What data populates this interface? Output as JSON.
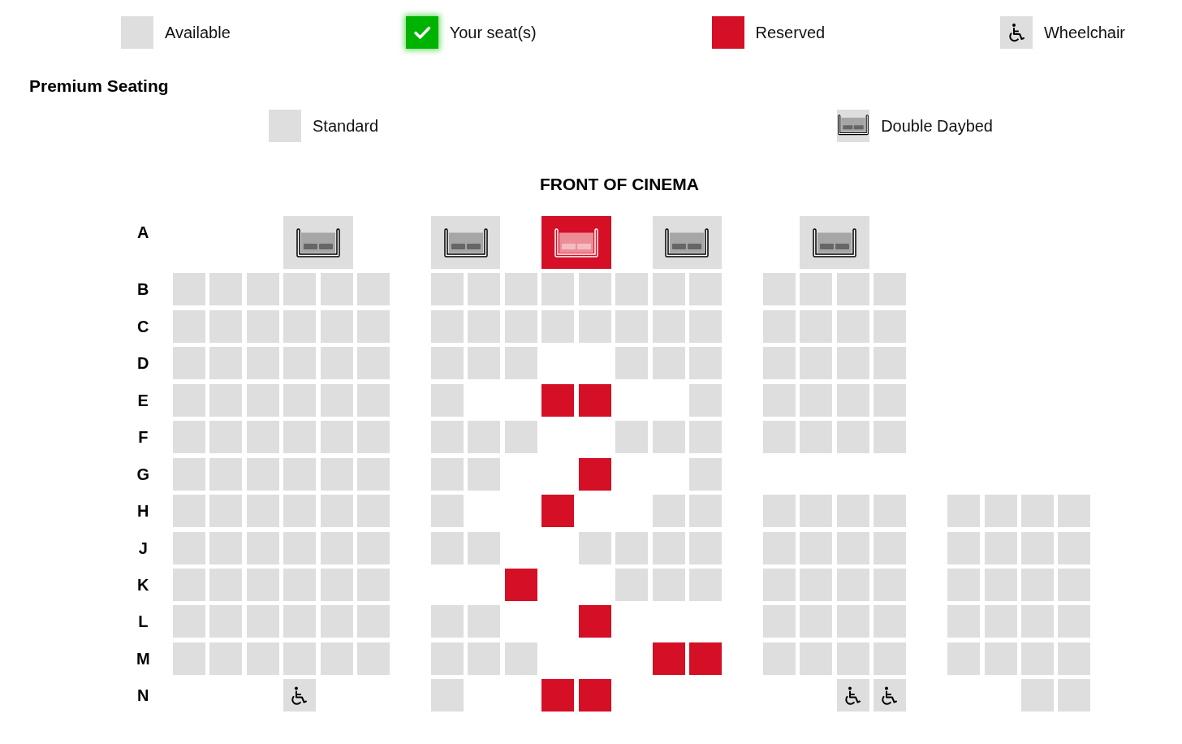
{
  "legend": [
    {
      "kind": "available",
      "label": "Available"
    },
    {
      "kind": "selected",
      "label": "Your seat(s)"
    },
    {
      "kind": "reserved",
      "label": "Reserved"
    },
    {
      "kind": "wheelchair",
      "label": "Wheelchair"
    }
  ],
  "premium": {
    "title": "Premium Seating",
    "legend": [
      {
        "kind": "standard",
        "label": "Standard"
      },
      {
        "kind": "daybed",
        "label": "Double Daybed"
      }
    ]
  },
  "screen_label": "FRONT OF CINEMA",
  "rows": [
    {
      "label": "A",
      "seats": [
        {
          "kind": "space"
        },
        {
          "kind": "space"
        },
        {
          "kind": "space"
        },
        {
          "kind": "daybed",
          "reserved": false
        },
        {
          "kind": "space"
        },
        {
          "kind": "space"
        },
        {
          "kind": "daybed",
          "reserved": false
        },
        {
          "kind": "space"
        },
        {
          "kind": "daybed",
          "reserved": true
        },
        {
          "kind": "space"
        },
        {
          "kind": "daybed",
          "reserved": false
        },
        {
          "kind": "space"
        },
        {
          "kind": "space"
        },
        {
          "kind": "daybed",
          "reserved": false
        }
      ]
    },
    {
      "label": "B",
      "seats": [
        {
          "kind": "seat",
          "reserved": false
        },
        {
          "kind": "seat",
          "reserved": false
        },
        {
          "kind": "seat",
          "reserved": false
        },
        {
          "kind": "seat",
          "reserved": false
        },
        {
          "kind": "seat",
          "reserved": false
        },
        {
          "kind": "seat",
          "reserved": false
        },
        {
          "kind": "space"
        },
        {
          "kind": "seat",
          "reserved": false
        },
        {
          "kind": "seat",
          "reserved": false
        },
        {
          "kind": "seat",
          "reserved": false
        },
        {
          "kind": "seat",
          "reserved": false
        },
        {
          "kind": "seat",
          "reserved": false
        },
        {
          "kind": "seat",
          "reserved": false
        },
        {
          "kind": "seat",
          "reserved": false
        },
        {
          "kind": "seat",
          "reserved": false
        },
        {
          "kind": "space"
        },
        {
          "kind": "seat",
          "reserved": false
        },
        {
          "kind": "seat",
          "reserved": false
        },
        {
          "kind": "seat",
          "reserved": false
        },
        {
          "kind": "seat",
          "reserved": false
        }
      ]
    },
    {
      "label": "C",
      "seats": [
        {
          "kind": "seat",
          "reserved": false
        },
        {
          "kind": "seat",
          "reserved": false
        },
        {
          "kind": "seat",
          "reserved": false
        },
        {
          "kind": "seat",
          "reserved": false
        },
        {
          "kind": "seat",
          "reserved": false
        },
        {
          "kind": "seat",
          "reserved": false
        },
        {
          "kind": "space"
        },
        {
          "kind": "seat",
          "reserved": false
        },
        {
          "kind": "seat",
          "reserved": false
        },
        {
          "kind": "seat",
          "reserved": false
        },
        {
          "kind": "seat",
          "reserved": false
        },
        {
          "kind": "seat",
          "reserved": false
        },
        {
          "kind": "seat",
          "reserved": false
        },
        {
          "kind": "seat",
          "reserved": false
        },
        {
          "kind": "seat",
          "reserved": false
        },
        {
          "kind": "space"
        },
        {
          "kind": "seat",
          "reserved": false
        },
        {
          "kind": "seat",
          "reserved": false
        },
        {
          "kind": "seat",
          "reserved": false
        },
        {
          "kind": "seat",
          "reserved": false
        }
      ]
    },
    {
      "label": "D",
      "seats": [
        {
          "kind": "seat",
          "reserved": false
        },
        {
          "kind": "seat",
          "reserved": false
        },
        {
          "kind": "seat",
          "reserved": false
        },
        {
          "kind": "seat",
          "reserved": false
        },
        {
          "kind": "seat",
          "reserved": false
        },
        {
          "kind": "seat",
          "reserved": false
        },
        {
          "kind": "space"
        },
        {
          "kind": "seat",
          "reserved": false
        },
        {
          "kind": "seat",
          "reserved": false
        },
        {
          "kind": "seat",
          "reserved": false
        },
        {
          "kind": "space"
        },
        {
          "kind": "space"
        },
        {
          "kind": "seat",
          "reserved": false
        },
        {
          "kind": "seat",
          "reserved": false
        },
        {
          "kind": "seat",
          "reserved": false
        },
        {
          "kind": "space"
        },
        {
          "kind": "seat",
          "reserved": false
        },
        {
          "kind": "seat",
          "reserved": false
        },
        {
          "kind": "seat",
          "reserved": false
        },
        {
          "kind": "seat",
          "reserved": false
        }
      ]
    },
    {
      "label": "E",
      "seats": [
        {
          "kind": "seat",
          "reserved": false
        },
        {
          "kind": "seat",
          "reserved": false
        },
        {
          "kind": "seat",
          "reserved": false
        },
        {
          "kind": "seat",
          "reserved": false
        },
        {
          "kind": "seat",
          "reserved": false
        },
        {
          "kind": "seat",
          "reserved": false
        },
        {
          "kind": "space"
        },
        {
          "kind": "seat",
          "reserved": false
        },
        {
          "kind": "space"
        },
        {
          "kind": "space"
        },
        {
          "kind": "seat",
          "reserved": true
        },
        {
          "kind": "seat",
          "reserved": true
        },
        {
          "kind": "space"
        },
        {
          "kind": "space"
        },
        {
          "kind": "seat",
          "reserved": false
        },
        {
          "kind": "space"
        },
        {
          "kind": "seat",
          "reserved": false
        },
        {
          "kind": "seat",
          "reserved": false
        },
        {
          "kind": "seat",
          "reserved": false
        },
        {
          "kind": "seat",
          "reserved": false
        }
      ]
    },
    {
      "label": "F",
      "seats": [
        {
          "kind": "seat",
          "reserved": false
        },
        {
          "kind": "seat",
          "reserved": false
        },
        {
          "kind": "seat",
          "reserved": false
        },
        {
          "kind": "seat",
          "reserved": false
        },
        {
          "kind": "seat",
          "reserved": false
        },
        {
          "kind": "seat",
          "reserved": false
        },
        {
          "kind": "space"
        },
        {
          "kind": "seat",
          "reserved": false
        },
        {
          "kind": "seat",
          "reserved": false
        },
        {
          "kind": "seat",
          "reserved": false
        },
        {
          "kind": "space"
        },
        {
          "kind": "space"
        },
        {
          "kind": "seat",
          "reserved": false
        },
        {
          "kind": "seat",
          "reserved": false
        },
        {
          "kind": "seat",
          "reserved": false
        },
        {
          "kind": "space"
        },
        {
          "kind": "seat",
          "reserved": false
        },
        {
          "kind": "seat",
          "reserved": false
        },
        {
          "kind": "seat",
          "reserved": false
        },
        {
          "kind": "seat",
          "reserved": false
        }
      ]
    },
    {
      "label": "G",
      "seats": [
        {
          "kind": "seat",
          "reserved": false
        },
        {
          "kind": "seat",
          "reserved": false
        },
        {
          "kind": "seat",
          "reserved": false
        },
        {
          "kind": "seat",
          "reserved": false
        },
        {
          "kind": "seat",
          "reserved": false
        },
        {
          "kind": "seat",
          "reserved": false
        },
        {
          "kind": "space"
        },
        {
          "kind": "seat",
          "reserved": false
        },
        {
          "kind": "seat",
          "reserved": false
        },
        {
          "kind": "space"
        },
        {
          "kind": "space"
        },
        {
          "kind": "seat",
          "reserved": true
        },
        {
          "kind": "space"
        },
        {
          "kind": "space"
        },
        {
          "kind": "seat",
          "reserved": false
        }
      ]
    },
    {
      "label": "H",
      "seats": [
        {
          "kind": "seat",
          "reserved": false
        },
        {
          "kind": "seat",
          "reserved": false
        },
        {
          "kind": "seat",
          "reserved": false
        },
        {
          "kind": "seat",
          "reserved": false
        },
        {
          "kind": "seat",
          "reserved": false
        },
        {
          "kind": "seat",
          "reserved": false
        },
        {
          "kind": "space"
        },
        {
          "kind": "seat",
          "reserved": false
        },
        {
          "kind": "space"
        },
        {
          "kind": "space"
        },
        {
          "kind": "seat",
          "reserved": true
        },
        {
          "kind": "space"
        },
        {
          "kind": "space"
        },
        {
          "kind": "seat",
          "reserved": false
        },
        {
          "kind": "seat",
          "reserved": false
        },
        {
          "kind": "space"
        },
        {
          "kind": "seat",
          "reserved": false
        },
        {
          "kind": "seat",
          "reserved": false
        },
        {
          "kind": "seat",
          "reserved": false
        },
        {
          "kind": "seat",
          "reserved": false
        },
        {
          "kind": "space"
        },
        {
          "kind": "seat",
          "reserved": false
        },
        {
          "kind": "seat",
          "reserved": false
        },
        {
          "kind": "seat",
          "reserved": false
        },
        {
          "kind": "seat",
          "reserved": false
        }
      ]
    },
    {
      "label": "J",
      "seats": [
        {
          "kind": "seat",
          "reserved": false
        },
        {
          "kind": "seat",
          "reserved": false
        },
        {
          "kind": "seat",
          "reserved": false
        },
        {
          "kind": "seat",
          "reserved": false
        },
        {
          "kind": "seat",
          "reserved": false
        },
        {
          "kind": "seat",
          "reserved": false
        },
        {
          "kind": "space"
        },
        {
          "kind": "seat",
          "reserved": false
        },
        {
          "kind": "seat",
          "reserved": false
        },
        {
          "kind": "space"
        },
        {
          "kind": "space"
        },
        {
          "kind": "seat",
          "reserved": false
        },
        {
          "kind": "seat",
          "reserved": false
        },
        {
          "kind": "seat",
          "reserved": false
        },
        {
          "kind": "seat",
          "reserved": false
        },
        {
          "kind": "space"
        },
        {
          "kind": "seat",
          "reserved": false
        },
        {
          "kind": "seat",
          "reserved": false
        },
        {
          "kind": "seat",
          "reserved": false
        },
        {
          "kind": "seat",
          "reserved": false
        },
        {
          "kind": "space"
        },
        {
          "kind": "seat",
          "reserved": false
        },
        {
          "kind": "seat",
          "reserved": false
        },
        {
          "kind": "seat",
          "reserved": false
        },
        {
          "kind": "seat",
          "reserved": false
        }
      ]
    },
    {
      "label": "K",
      "seats": [
        {
          "kind": "seat",
          "reserved": false
        },
        {
          "kind": "seat",
          "reserved": false
        },
        {
          "kind": "seat",
          "reserved": false
        },
        {
          "kind": "seat",
          "reserved": false
        },
        {
          "kind": "seat",
          "reserved": false
        },
        {
          "kind": "seat",
          "reserved": false
        },
        {
          "kind": "space"
        },
        {
          "kind": "space"
        },
        {
          "kind": "space"
        },
        {
          "kind": "seat",
          "reserved": true
        },
        {
          "kind": "space"
        },
        {
          "kind": "space"
        },
        {
          "kind": "seat",
          "reserved": false
        },
        {
          "kind": "seat",
          "reserved": false
        },
        {
          "kind": "seat",
          "reserved": false
        },
        {
          "kind": "space"
        },
        {
          "kind": "seat",
          "reserved": false
        },
        {
          "kind": "seat",
          "reserved": false
        },
        {
          "kind": "seat",
          "reserved": false
        },
        {
          "kind": "seat",
          "reserved": false
        },
        {
          "kind": "space"
        },
        {
          "kind": "seat",
          "reserved": false
        },
        {
          "kind": "seat",
          "reserved": false
        },
        {
          "kind": "seat",
          "reserved": false
        },
        {
          "kind": "seat",
          "reserved": false
        }
      ]
    },
    {
      "label": "L",
      "seats": [
        {
          "kind": "seat",
          "reserved": false
        },
        {
          "kind": "seat",
          "reserved": false
        },
        {
          "kind": "seat",
          "reserved": false
        },
        {
          "kind": "seat",
          "reserved": false
        },
        {
          "kind": "seat",
          "reserved": false
        },
        {
          "kind": "seat",
          "reserved": false
        },
        {
          "kind": "space"
        },
        {
          "kind": "seat",
          "reserved": false
        },
        {
          "kind": "seat",
          "reserved": false
        },
        {
          "kind": "space"
        },
        {
          "kind": "space"
        },
        {
          "kind": "seat",
          "reserved": true
        },
        {
          "kind": "space"
        },
        {
          "kind": "space"
        },
        {
          "kind": "space"
        },
        {
          "kind": "space"
        },
        {
          "kind": "seat",
          "reserved": false
        },
        {
          "kind": "seat",
          "reserved": false
        },
        {
          "kind": "seat",
          "reserved": false
        },
        {
          "kind": "seat",
          "reserved": false
        },
        {
          "kind": "space"
        },
        {
          "kind": "seat",
          "reserved": false
        },
        {
          "kind": "seat",
          "reserved": false
        },
        {
          "kind": "seat",
          "reserved": false
        },
        {
          "kind": "seat",
          "reserved": false
        }
      ]
    },
    {
      "label": "M",
      "seats": [
        {
          "kind": "seat",
          "reserved": false
        },
        {
          "kind": "seat",
          "reserved": false
        },
        {
          "kind": "seat",
          "reserved": false
        },
        {
          "kind": "seat",
          "reserved": false
        },
        {
          "kind": "seat",
          "reserved": false
        },
        {
          "kind": "seat",
          "reserved": false
        },
        {
          "kind": "space"
        },
        {
          "kind": "seat",
          "reserved": false
        },
        {
          "kind": "seat",
          "reserved": false
        },
        {
          "kind": "seat",
          "reserved": false
        },
        {
          "kind": "space"
        },
        {
          "kind": "space"
        },
        {
          "kind": "space"
        },
        {
          "kind": "seat",
          "reserved": true
        },
        {
          "kind": "seat",
          "reserved": true
        },
        {
          "kind": "space"
        },
        {
          "kind": "seat",
          "reserved": false
        },
        {
          "kind": "seat",
          "reserved": false
        },
        {
          "kind": "seat",
          "reserved": false
        },
        {
          "kind": "seat",
          "reserved": false
        },
        {
          "kind": "space"
        },
        {
          "kind": "seat",
          "reserved": false
        },
        {
          "kind": "seat",
          "reserved": false
        },
        {
          "kind": "seat",
          "reserved": false
        },
        {
          "kind": "seat",
          "reserved": false
        }
      ]
    },
    {
      "label": "N",
      "seats": [
        {
          "kind": "space"
        },
        {
          "kind": "space"
        },
        {
          "kind": "space"
        },
        {
          "kind": "wheelchair",
          "reserved": false
        },
        {
          "kind": "space"
        },
        {
          "kind": "space"
        },
        {
          "kind": "space"
        },
        {
          "kind": "seat",
          "reserved": false
        },
        {
          "kind": "space"
        },
        {
          "kind": "space"
        },
        {
          "kind": "seat",
          "reserved": true
        },
        {
          "kind": "seat",
          "reserved": true
        },
        {
          "kind": "space"
        },
        {
          "kind": "space"
        },
        {
          "kind": "space"
        },
        {
          "kind": "space"
        },
        {
          "kind": "space"
        },
        {
          "kind": "space"
        },
        {
          "kind": "wheelchair",
          "reserved": false
        },
        {
          "kind": "wheelchair",
          "reserved": false
        },
        {
          "kind": "space"
        },
        {
          "kind": "space"
        },
        {
          "kind": "space"
        },
        {
          "kind": "seat",
          "reserved": false
        },
        {
          "kind": "seat",
          "reserved": false
        }
      ]
    }
  ]
}
